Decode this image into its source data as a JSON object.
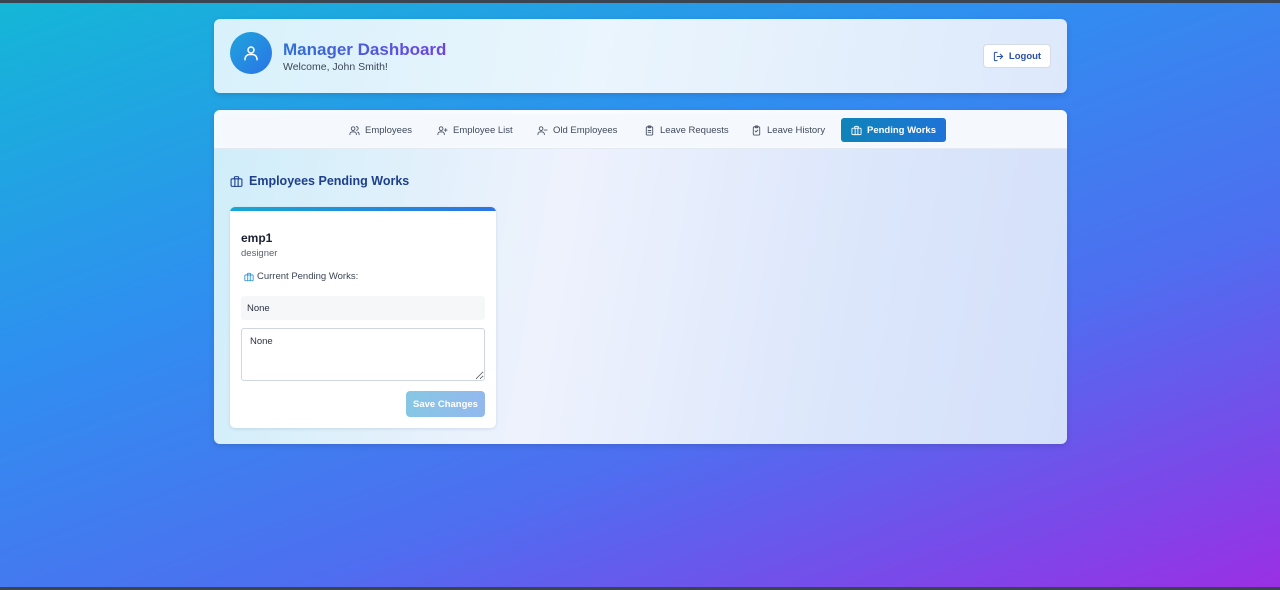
{
  "header": {
    "title": "Manager Dashboard",
    "welcome": "Welcome, John Smith!",
    "logout_label": "Logout"
  },
  "tabs": [
    {
      "label": "Employees",
      "icon": "users-icon",
      "active": false
    },
    {
      "label": "Employee List",
      "icon": "user-plus-icon",
      "active": false
    },
    {
      "label": "Old Employees",
      "icon": "user-minus-icon",
      "active": false
    },
    {
      "label": "Leave Requests",
      "icon": "clipboard-icon",
      "active": false
    },
    {
      "label": "Leave History",
      "icon": "clipboard-check-icon",
      "active": false
    },
    {
      "label": "Pending Works",
      "icon": "briefcase-icon",
      "active": true
    }
  ],
  "section": {
    "title": "Employees Pending Works",
    "icon": "briefcase-icon"
  },
  "employee_card": {
    "name": "emp1",
    "role": "designer",
    "pending_label": "Current Pending Works:",
    "pending_value": "None",
    "textarea_value": "None",
    "save_label": "Save Changes"
  },
  "colors": {
    "accent": "#1e73d8",
    "active_tab": "#0f84b8",
    "title_gradient_start": "#2f6fd8",
    "title_gradient_end": "#6f44e0"
  }
}
